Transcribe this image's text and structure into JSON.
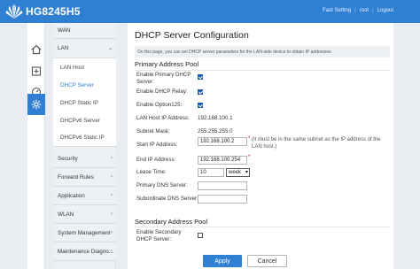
{
  "header": {
    "model": "HG8245H5",
    "links": [
      "Fast Setting",
      "root",
      "Logout"
    ]
  },
  "rail": [
    "home-icon",
    "add-icon",
    "dashboard-icon",
    "gear-icon"
  ],
  "nav": {
    "sections": [
      {
        "label": "WAN"
      },
      {
        "label": "LAN"
      },
      {
        "label": "Security"
      },
      {
        "label": "Forward Rules"
      },
      {
        "label": "Application"
      },
      {
        "label": "WLAN"
      },
      {
        "label": "System Management"
      },
      {
        "label": "Maintenance Diagno..."
      }
    ],
    "lan_items": [
      "LAN Host",
      "DHCP Server",
      "DHCP Static IP",
      "DHCPv6 Server",
      "DHCPv6 Static IP"
    ]
  },
  "page": {
    "title": "DHCP Server Configuration",
    "description": "On this page, you can set DHCP server parameters for the LAN-side device to obtain IP addresses.",
    "primary_title": "Primary Address Pool",
    "secondary_title": "Secondary Address Pool",
    "labels": {
      "enable_primary": "Enable Primary DHCP Server:",
      "enable_relay": "Enable DHCP Relay:",
      "enable_opt125": "Enable Option125:",
      "lan_host_ip": "LAN Host IP Address:",
      "subnet_mask": "Subnet Mask:",
      "start_ip": "Start IP Address:",
      "end_ip": "End IP Address:",
      "lease_time": "Lease Time:",
      "primary_dns": "Primary DNS Server:",
      "secondary_dns": "Subordinate DNS Server:",
      "enable_secondary": "Enable Secondary DHCP Server:"
    },
    "values": {
      "lan_host_ip": "192.168.100.1",
      "subnet_mask": "255.255.255.0",
      "start_ip": "192.168.100.2",
      "end_ip": "192.168.100.254",
      "lease_time": "10",
      "lease_unit": "week",
      "primary_dns": "",
      "secondary_dns": ""
    },
    "required_mark": "*",
    "start_ip_hint": "(It must be in the same subnet as the IP address of the LAN host.)",
    "buttons": {
      "apply": "Apply",
      "cancel": "Cancel"
    }
  }
}
